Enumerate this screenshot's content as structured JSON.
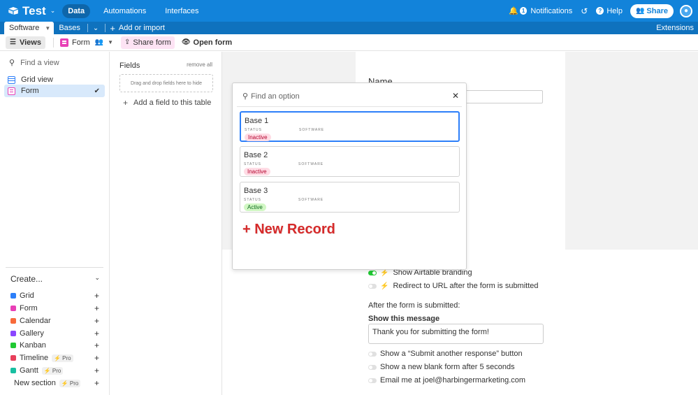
{
  "topbar": {
    "base_name": "Test",
    "nav": [
      "Data",
      "Automations",
      "Interfaces"
    ],
    "notifications_label": "Notifications",
    "notifications_count": "1",
    "help_label": "Help",
    "share_label": "Share",
    "accent": "#1283da"
  },
  "tabs": {
    "active": "Software",
    "other": "Bases",
    "add_import": "Add or import",
    "extensions": "Extensions"
  },
  "viewbar": {
    "views_label": "Views",
    "view_name": "Form",
    "share_form": "Share form",
    "open_form": "Open form"
  },
  "sidebar": {
    "find_placeholder": "Find a view",
    "views": [
      {
        "label": "Grid view"
      },
      {
        "label": "Form"
      }
    ],
    "create_label": "Create...",
    "create_items": [
      {
        "label": "Grid",
        "color": "#2d7ff9"
      },
      {
        "label": "Form",
        "color": "#e83fb6"
      },
      {
        "label": "Calendar",
        "color": "#f86a3a"
      },
      {
        "label": "Gallery",
        "color": "#8b46ff"
      },
      {
        "label": "Kanban",
        "color": "#20c933"
      },
      {
        "label": "Timeline",
        "color": "#e83f5b",
        "badge": "Pro"
      },
      {
        "label": "Gantt",
        "color": "#18bfa1",
        "badge": "Pro"
      }
    ],
    "new_section": "New section",
    "new_section_badge": "Pro"
  },
  "fields": {
    "title": "Fields",
    "remove_all": "remove all",
    "drop_hint": "Drag and drop fields here to hide",
    "add_field": "Add a field to this table"
  },
  "form": {
    "name_label": "Name",
    "options": [
      {
        "label": "Show Airtable branding",
        "on": true,
        "spark": true
      },
      {
        "label": "Redirect to URL after the form is submitted",
        "on": false,
        "spark": true
      }
    ],
    "after_label": "After the form is submitted:",
    "show_message_label": "Show this message",
    "message": "Thank you for submitting the form!",
    "post_options": [
      {
        "label": "Show a “Submit another response” button",
        "on": false
      },
      {
        "label": "Show a new blank form after 5 seconds",
        "on": false
      },
      {
        "label": "Email me at joel@harbingermarketing.com",
        "on": false
      }
    ]
  },
  "popup": {
    "search_placeholder": "Find an option",
    "status_label": "STATUS",
    "software_label": "SOFTWARE",
    "records": [
      {
        "title": "Base 1",
        "status": "Inactive"
      },
      {
        "title": "Base 2",
        "status": "Inactive"
      },
      {
        "title": "Base 3",
        "status": "Active"
      }
    ],
    "new_record": "+ New Record"
  }
}
